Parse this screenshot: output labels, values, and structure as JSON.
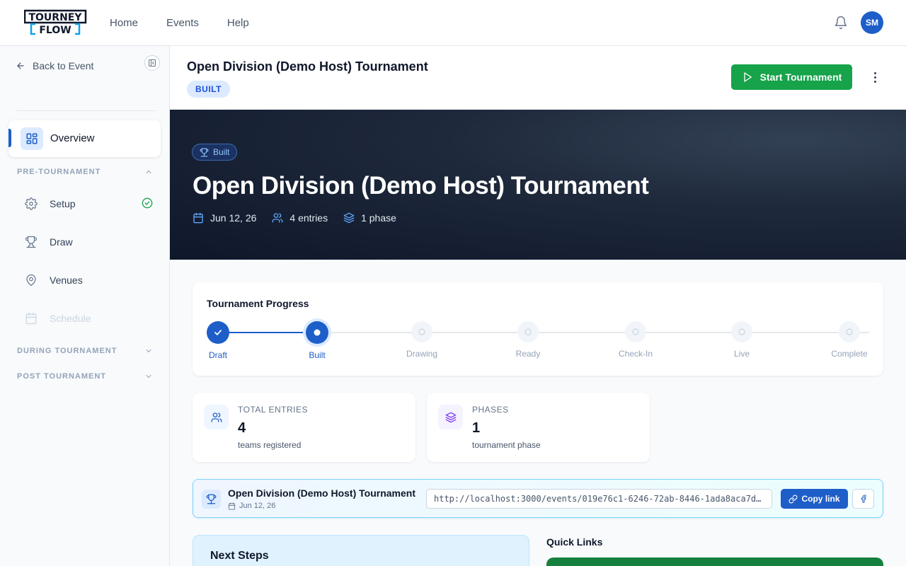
{
  "app": {
    "brand": "TOURNEY FLOW",
    "brand_line1": "TOURNEY",
    "brand_line2": "FLOW",
    "nav": [
      {
        "label": "Home"
      },
      {
        "label": "Events"
      },
      {
        "label": "Help"
      }
    ],
    "user_initials": "SM"
  },
  "sidebar": {
    "back_label": "Back to Event",
    "overview_label": "Overview",
    "sections": {
      "pre": {
        "label": "PRE-TOURNAMENT"
      },
      "during": {
        "label": "DURING TOURNAMENT"
      },
      "post": {
        "label": "POST TOURNAMENT"
      }
    },
    "items": [
      {
        "label": "Setup",
        "icon": "gear-icon",
        "completed": true
      },
      {
        "label": "Draw",
        "icon": "trophy-icon"
      },
      {
        "label": "Venues",
        "icon": "map-pin-icon"
      },
      {
        "label": "Schedule",
        "icon": "calendar-icon",
        "disabled": true
      }
    ]
  },
  "header": {
    "title": "Open Division (Demo Host) Tournament",
    "status_badge": "BUILT",
    "start_button": "Start Tournament"
  },
  "hero": {
    "badge": "Built",
    "title": "Open Division (Demo Host) Tournament",
    "date": "Jun 12, 26",
    "entries": "4 entries",
    "phases": "1 phase"
  },
  "progress": {
    "title": "Tournament Progress",
    "steps": [
      {
        "label": "Draft",
        "state": "done"
      },
      {
        "label": "Built",
        "state": "current"
      },
      {
        "label": "Drawing",
        "state": "todo"
      },
      {
        "label": "Ready",
        "state": "todo"
      },
      {
        "label": "Check-In",
        "state": "todo"
      },
      {
        "label": "Live",
        "state": "todo"
      },
      {
        "label": "Complete",
        "state": "todo"
      }
    ]
  },
  "stats": {
    "entries": {
      "label": "TOTAL ENTRIES",
      "value": "4",
      "sub": "teams registered"
    },
    "phases": {
      "label": "PHASES",
      "value": "1",
      "sub": "tournament phase"
    }
  },
  "share": {
    "title": "Open Division (Demo Host) Tournament",
    "date": "Jun 12, 26",
    "url": "http://localhost:3000/events/019e76c1-6246-72ab-8446-1ada8aca7d…",
    "copy_label": "Copy link"
  },
  "next_steps": {
    "title": "Next Steps"
  },
  "quick_links": {
    "title": "Quick Links"
  },
  "colors": {
    "accent": "#1d5ec9",
    "success": "#16a34a",
    "hero_bg": "#0f172a"
  }
}
